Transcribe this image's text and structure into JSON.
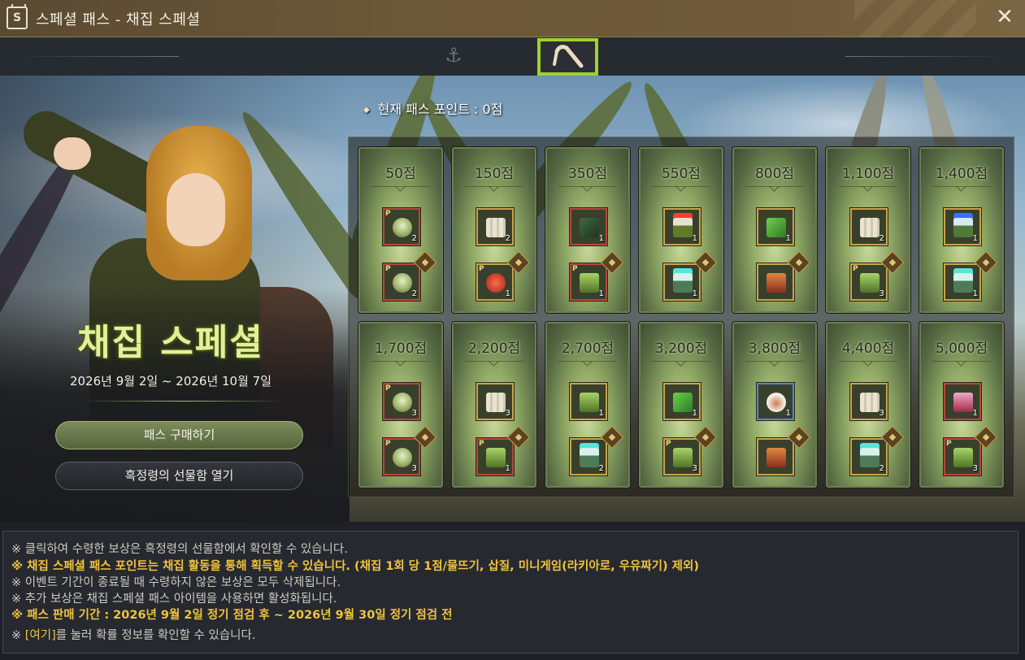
{
  "window": {
    "title": "스페셜 패스 - 채집 스페셜",
    "title_icon": "calendar-s-icon",
    "close_icon": "close-icon"
  },
  "tabs": [
    {
      "icon": "anchor-icon",
      "selected": false
    },
    {
      "icon": "pickaxe-icon",
      "selected": true
    }
  ],
  "hero": {
    "event_title": "채집 스페셜",
    "event_period": "2026년 9월 2일 ~ 2026년 10월 7일",
    "buy_button": "패스 구매하기",
    "gift_button": "흑정령의 선물함 열기"
  },
  "points": {
    "label": "현재 패스 포인트 : 0점"
  },
  "rewards": [
    {
      "points": "50점",
      "top": {
        "icon": "bowl",
        "count": "2",
        "premium": true,
        "frame": "red"
      },
      "bottom": {
        "icon": "bowl",
        "count": "2",
        "premium": true,
        "frame": "red"
      }
    },
    {
      "points": "150점",
      "top": {
        "icon": "map",
        "count": "2",
        "premium": false,
        "frame": "gold"
      },
      "bottom": {
        "icon": "monster",
        "count": "1",
        "premium": true,
        "frame": "gold"
      }
    },
    {
      "points": "350점",
      "top": {
        "icon": "book",
        "count": "1",
        "premium": false,
        "frame": "red"
      },
      "bottom": {
        "icon": "chest-g",
        "count": "1",
        "premium": true,
        "frame": "red"
      }
    },
    {
      "points": "550점",
      "top": {
        "icon": "chest-r",
        "count": "1",
        "premium": false,
        "frame": "gold"
      },
      "bottom": {
        "icon": "chest-c",
        "count": "1",
        "premium": false,
        "frame": "gold"
      }
    },
    {
      "points": "800점",
      "top": {
        "icon": "scroll",
        "count": "1",
        "premium": false,
        "frame": "gold"
      },
      "bottom": {
        "icon": "chest-o",
        "count": "",
        "premium": false,
        "frame": "gold"
      }
    },
    {
      "points": "1,100점",
      "top": {
        "icon": "map",
        "count": "2",
        "premium": false,
        "frame": "gold"
      },
      "bottom": {
        "icon": "chest-g",
        "count": "3",
        "premium": true,
        "frame": "gold"
      }
    },
    {
      "points": "1,400점",
      "top": {
        "icon": "chest-b",
        "count": "1",
        "premium": false,
        "frame": "gold"
      },
      "bottom": {
        "icon": "chest-c",
        "count": "1",
        "premium": false,
        "frame": "gold"
      }
    },
    {
      "points": "1,700점",
      "top": {
        "icon": "bowl",
        "count": "3",
        "premium": true,
        "frame": "red"
      },
      "bottom": {
        "icon": "bowl",
        "count": "3",
        "premium": true,
        "frame": "red"
      }
    },
    {
      "points": "2,200점",
      "top": {
        "icon": "map",
        "count": "3",
        "premium": false,
        "frame": "gold"
      },
      "bottom": {
        "icon": "chest-g",
        "count": "1",
        "premium": true,
        "frame": "red"
      }
    },
    {
      "points": "2,700점",
      "top": {
        "icon": "chest-g",
        "count": "1",
        "premium": false,
        "frame": "gold"
      },
      "bottom": {
        "icon": "chest-c",
        "count": "2",
        "premium": false,
        "frame": "gold"
      }
    },
    {
      "points": "3,200점",
      "top": {
        "icon": "scroll",
        "count": "1",
        "premium": false,
        "frame": "gold"
      },
      "bottom": {
        "icon": "chest-g",
        "count": "3",
        "premium": true,
        "frame": "gold"
      }
    },
    {
      "points": "3,800점",
      "top": {
        "icon": "cup",
        "count": "1",
        "premium": false,
        "frame": "blue"
      },
      "bottom": {
        "icon": "chest-o",
        "count": "",
        "premium": false,
        "frame": "gold"
      }
    },
    {
      "points": "4,400점",
      "top": {
        "icon": "map",
        "count": "3",
        "premium": false,
        "frame": "gold"
      },
      "bottom": {
        "icon": "chest-c",
        "count": "2",
        "premium": false,
        "frame": "gold"
      }
    },
    {
      "points": "5,000점",
      "top": {
        "icon": "chest-p",
        "count": "1",
        "premium": false,
        "frame": "red"
      },
      "bottom": {
        "icon": "chest-g",
        "count": "3",
        "premium": true,
        "frame": "red"
      }
    }
  ],
  "notes": [
    {
      "text": "※ 클릭하여 수령한 보상은 흑정령의 선물함에서 확인할 수 있습니다.",
      "highlight": false
    },
    {
      "text": "※ 채집 스페셜 패스 포인트는 채집 활동을 통해 획득할 수 있습니다. (채집 1회 당 1점/물뜨기, 삽질, 미니게임(라키아로, 우유짜기) 제외)",
      "highlight": true
    },
    {
      "text": "※ 이벤트 기간이 종료될 때 수령하지 않은 보상은 모두 삭제됩니다.",
      "highlight": false
    },
    {
      "text": "※ 추가 보상은 채집 스페셜 패스 아이템을 사용하면 활성화됩니다.",
      "highlight": false
    },
    {
      "text": "※ 패스 판매 기간 : 2026년 9월 2일 정기 점검 후 ~ 2026년 9월 30일 정기 점검 전",
      "highlight": true
    }
  ],
  "last_note": {
    "prefix": "※ ",
    "link": "[여기]",
    "suffix": "를 눌러 확률 정보를 확인할 수 있습니다."
  }
}
